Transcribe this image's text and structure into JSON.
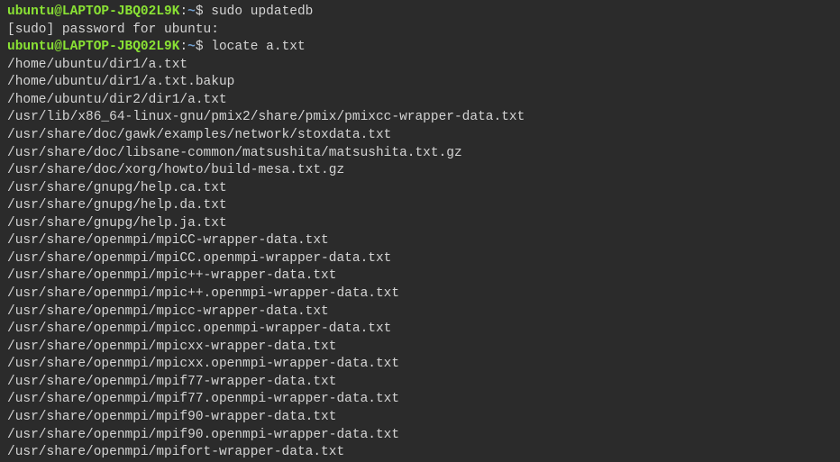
{
  "lines": [
    {
      "type": "prompt",
      "userHost": "ubuntu@LAPTOP-JBQ02L9K",
      "path": "~",
      "command": "sudo updatedb"
    },
    {
      "type": "output",
      "text": "[sudo] password for ubuntu:"
    },
    {
      "type": "prompt",
      "userHost": "ubuntu@LAPTOP-JBQ02L9K",
      "path": "~",
      "command": "locate a.txt"
    },
    {
      "type": "output",
      "text": "/home/ubuntu/dir1/a.txt"
    },
    {
      "type": "output",
      "text": "/home/ubuntu/dir1/a.txt.bakup"
    },
    {
      "type": "output",
      "text": "/home/ubuntu/dir2/dir1/a.txt"
    },
    {
      "type": "output",
      "text": "/usr/lib/x86_64-linux-gnu/pmix2/share/pmix/pmixcc-wrapper-data.txt"
    },
    {
      "type": "output",
      "text": "/usr/share/doc/gawk/examples/network/stoxdata.txt"
    },
    {
      "type": "output",
      "text": "/usr/share/doc/libsane-common/matsushita/matsushita.txt.gz"
    },
    {
      "type": "output",
      "text": "/usr/share/doc/xorg/howto/build-mesa.txt.gz"
    },
    {
      "type": "output",
      "text": "/usr/share/gnupg/help.ca.txt"
    },
    {
      "type": "output",
      "text": "/usr/share/gnupg/help.da.txt"
    },
    {
      "type": "output",
      "text": "/usr/share/gnupg/help.ja.txt"
    },
    {
      "type": "output",
      "text": "/usr/share/openmpi/mpiCC-wrapper-data.txt"
    },
    {
      "type": "output",
      "text": "/usr/share/openmpi/mpiCC.openmpi-wrapper-data.txt"
    },
    {
      "type": "output",
      "text": "/usr/share/openmpi/mpic++-wrapper-data.txt"
    },
    {
      "type": "output",
      "text": "/usr/share/openmpi/mpic++.openmpi-wrapper-data.txt"
    },
    {
      "type": "output",
      "text": "/usr/share/openmpi/mpicc-wrapper-data.txt"
    },
    {
      "type": "output",
      "text": "/usr/share/openmpi/mpicc.openmpi-wrapper-data.txt"
    },
    {
      "type": "output",
      "text": "/usr/share/openmpi/mpicxx-wrapper-data.txt"
    },
    {
      "type": "output",
      "text": "/usr/share/openmpi/mpicxx.openmpi-wrapper-data.txt"
    },
    {
      "type": "output",
      "text": "/usr/share/openmpi/mpif77-wrapper-data.txt"
    },
    {
      "type": "output",
      "text": "/usr/share/openmpi/mpif77.openmpi-wrapper-data.txt"
    },
    {
      "type": "output",
      "text": "/usr/share/openmpi/mpif90-wrapper-data.txt"
    },
    {
      "type": "output",
      "text": "/usr/share/openmpi/mpif90.openmpi-wrapper-data.txt"
    },
    {
      "type": "output",
      "text": "/usr/share/openmpi/mpifort-wrapper-data.txt"
    }
  ]
}
